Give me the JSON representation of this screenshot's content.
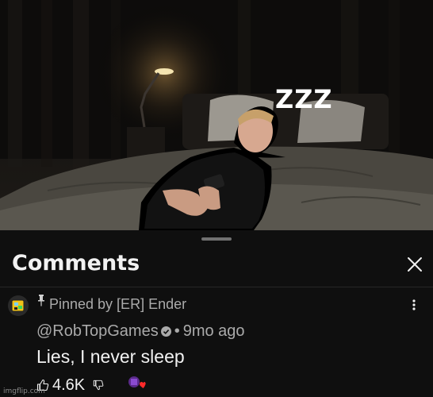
{
  "image": {
    "caption": "ZZZ"
  },
  "comments_panel": {
    "title": "Comments",
    "close_icon": "close-icon"
  },
  "comment": {
    "pinned_text": "Pinned by [ER] Ender",
    "author": "@RobTopGames",
    "separator": "•",
    "time": "9mo ago",
    "text": "Lies, I never sleep",
    "likes": "4.6K",
    "icons": [
      "avatar",
      "pin-icon",
      "verified-icon",
      "more-vert-icon",
      "thumb-up-icon",
      "thumb-down-icon",
      "creator-heart-icon"
    ]
  },
  "watermark": "imgflip.com",
  "colors": {
    "background": "#0f0f0f",
    "text_primary": "#f1f1f1",
    "text_secondary": "#aaaaaa",
    "divider": "#272727",
    "heart": "#ff2a2a"
  }
}
